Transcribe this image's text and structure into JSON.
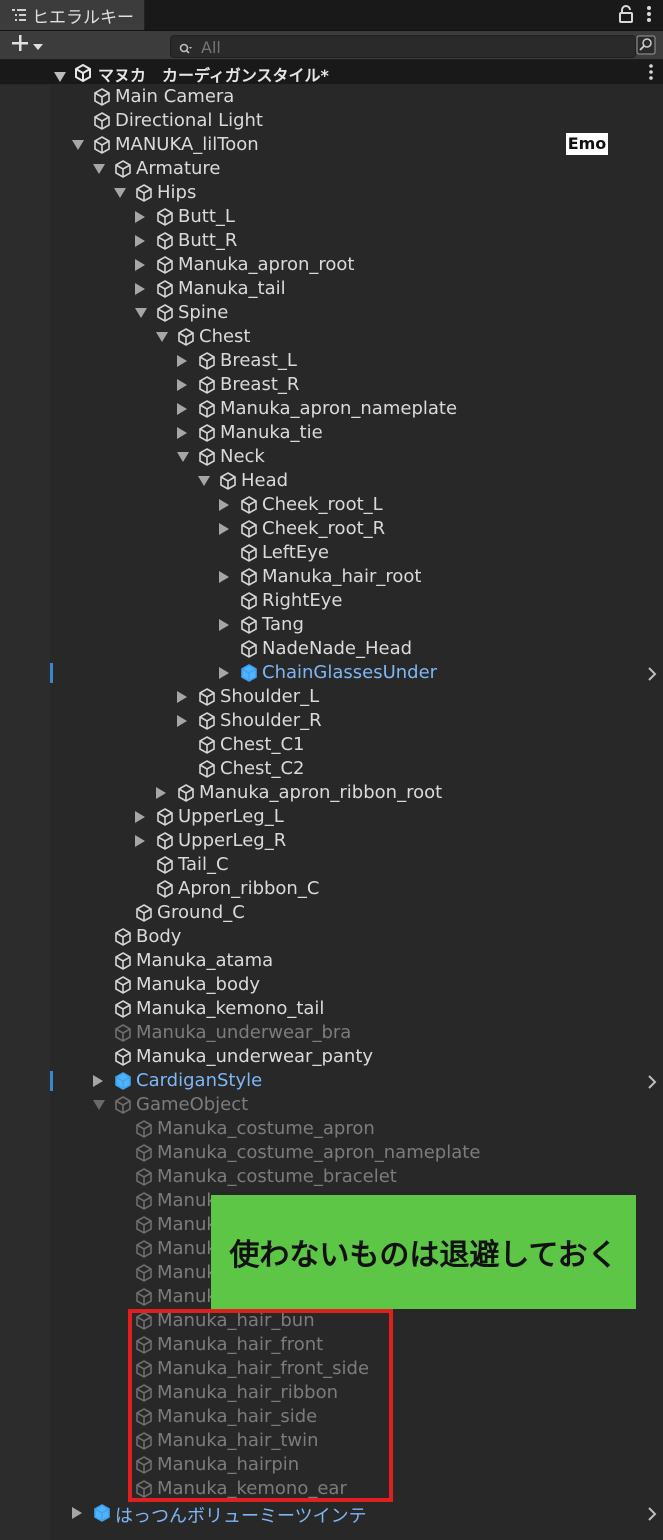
{
  "tab": {
    "label": "ヒエラルキー"
  },
  "search": {
    "placeholder": "All",
    "value": ""
  },
  "scene": {
    "title": "マヌカ　カーディガンスタイル*"
  },
  "badge": {
    "text": "Emo"
  },
  "callout": {
    "text": "使わないものは退避しておく"
  },
  "colors": {
    "background": "#282828",
    "prefab": "#7fb6f4",
    "inactive": "#7c7c7c",
    "callout": "#5ec646",
    "highlight": "#e0201e"
  },
  "rows": [
    {
      "label": "Main Camera",
      "depth": 0,
      "arrow": "none",
      "state": "normal"
    },
    {
      "label": "Directional Light",
      "depth": 0,
      "arrow": "none",
      "state": "normal"
    },
    {
      "label": "MANUKA_lilToon",
      "depth": 0,
      "arrow": "expanded",
      "state": "normal"
    },
    {
      "label": "Armature",
      "depth": 1,
      "arrow": "expanded",
      "state": "normal"
    },
    {
      "label": "Hips",
      "depth": 2,
      "arrow": "expanded",
      "state": "normal"
    },
    {
      "label": "Butt_L",
      "depth": 3,
      "arrow": "collapsed",
      "state": "normal"
    },
    {
      "label": "Butt_R",
      "depth": 3,
      "arrow": "collapsed",
      "state": "normal"
    },
    {
      "label": "Manuka_apron_root",
      "depth": 3,
      "arrow": "collapsed",
      "state": "normal"
    },
    {
      "label": "Manuka_tail",
      "depth": 3,
      "arrow": "collapsed",
      "state": "normal"
    },
    {
      "label": "Spine",
      "depth": 3,
      "arrow": "expanded",
      "state": "normal"
    },
    {
      "label": "Chest",
      "depth": 4,
      "arrow": "expanded",
      "state": "normal"
    },
    {
      "label": "Breast_L",
      "depth": 5,
      "arrow": "collapsed",
      "state": "normal"
    },
    {
      "label": "Breast_R",
      "depth": 5,
      "arrow": "collapsed",
      "state": "normal"
    },
    {
      "label": "Manuka_apron_nameplate",
      "depth": 5,
      "arrow": "collapsed",
      "state": "normal"
    },
    {
      "label": "Manuka_tie",
      "depth": 5,
      "arrow": "collapsed",
      "state": "normal"
    },
    {
      "label": "Neck",
      "depth": 5,
      "arrow": "expanded",
      "state": "normal"
    },
    {
      "label": "Head",
      "depth": 6,
      "arrow": "expanded",
      "state": "normal"
    },
    {
      "label": "Cheek_root_L",
      "depth": 7,
      "arrow": "collapsed",
      "state": "normal"
    },
    {
      "label": "Cheek_root_R",
      "depth": 7,
      "arrow": "collapsed",
      "state": "normal"
    },
    {
      "label": "LeftEye",
      "depth": 7,
      "arrow": "none",
      "state": "normal"
    },
    {
      "label": "Manuka_hair_root",
      "depth": 7,
      "arrow": "collapsed",
      "state": "normal"
    },
    {
      "label": "RightEye",
      "depth": 7,
      "arrow": "none",
      "state": "normal"
    },
    {
      "label": "Tang",
      "depth": 7,
      "arrow": "collapsed",
      "state": "normal"
    },
    {
      "label": "NadeNade_Head",
      "depth": 7,
      "arrow": "none",
      "state": "normal"
    },
    {
      "label": "ChainGlassesUnder",
      "depth": 7,
      "arrow": "collapsed",
      "state": "prefab"
    },
    {
      "label": "Shoulder_L",
      "depth": 5,
      "arrow": "collapsed",
      "state": "normal"
    },
    {
      "label": "Shoulder_R",
      "depth": 5,
      "arrow": "collapsed",
      "state": "normal"
    },
    {
      "label": "Chest_C1",
      "depth": 5,
      "arrow": "none",
      "state": "normal"
    },
    {
      "label": "Chest_C2",
      "depth": 5,
      "arrow": "none",
      "state": "normal"
    },
    {
      "label": "Manuka_apron_ribbon_root",
      "depth": 4,
      "arrow": "collapsed",
      "state": "normal"
    },
    {
      "label": "UpperLeg_L",
      "depth": 3,
      "arrow": "collapsed",
      "state": "normal"
    },
    {
      "label": "UpperLeg_R",
      "depth": 3,
      "arrow": "collapsed",
      "state": "normal"
    },
    {
      "label": "Tail_C",
      "depth": 3,
      "arrow": "none",
      "state": "normal"
    },
    {
      "label": "Apron_ribbon_C",
      "depth": 3,
      "arrow": "none",
      "state": "normal"
    },
    {
      "label": "Ground_C",
      "depth": 2,
      "arrow": "none",
      "state": "normal"
    },
    {
      "label": "Body",
      "depth": 1,
      "arrow": "none",
      "state": "normal"
    },
    {
      "label": "Manuka_atama",
      "depth": 1,
      "arrow": "none",
      "state": "normal"
    },
    {
      "label": "Manuka_body",
      "depth": 1,
      "arrow": "none",
      "state": "normal"
    },
    {
      "label": "Manuka_kemono_tail",
      "depth": 1,
      "arrow": "none",
      "state": "normal"
    },
    {
      "label": "Manuka_underwear_bra",
      "depth": 1,
      "arrow": "none",
      "state": "inactive"
    },
    {
      "label": "Manuka_underwear_panty",
      "depth": 1,
      "arrow": "none",
      "state": "normal"
    },
    {
      "label": "CardiganStyle",
      "depth": 1,
      "arrow": "collapsed",
      "state": "prefab"
    },
    {
      "label": "GameObject",
      "depth": 1,
      "arrow": "expanded",
      "state": "inactive"
    },
    {
      "label": "Manuka_costume_apron",
      "depth": 2,
      "arrow": "none",
      "state": "inactive"
    },
    {
      "label": "Manuka_costume_apron_nameplate",
      "depth": 2,
      "arrow": "none",
      "state": "inactive"
    },
    {
      "label": "Manuka_costume_bracelet",
      "depth": 2,
      "arrow": "none",
      "state": "inactive"
    },
    {
      "label": "Manuka",
      "depth": 2,
      "arrow": "none",
      "state": "inactive"
    },
    {
      "label": "Manuka",
      "depth": 2,
      "arrow": "none",
      "state": "inactive"
    },
    {
      "label": "Manuka",
      "depth": 2,
      "arrow": "none",
      "state": "inactive"
    },
    {
      "label": "Manuka",
      "depth": 2,
      "arrow": "none",
      "state": "inactive"
    },
    {
      "label": "Manuka",
      "depth": 2,
      "arrow": "none",
      "state": "inactive"
    },
    {
      "label": "Manuka_hair_bun",
      "depth": 2,
      "arrow": "none",
      "state": "inactive"
    },
    {
      "label": "Manuka_hair_front",
      "depth": 2,
      "arrow": "none",
      "state": "inactive"
    },
    {
      "label": "Manuka_hair_front_side",
      "depth": 2,
      "arrow": "none",
      "state": "inactive"
    },
    {
      "label": "Manuka_hair_ribbon",
      "depth": 2,
      "arrow": "none",
      "state": "inactive"
    },
    {
      "label": "Manuka_hair_side",
      "depth": 2,
      "arrow": "none",
      "state": "inactive"
    },
    {
      "label": "Manuka_hair_twin",
      "depth": 2,
      "arrow": "none",
      "state": "inactive"
    },
    {
      "label": "Manuka_hairpin",
      "depth": 2,
      "arrow": "none",
      "state": "inactive"
    },
    {
      "label": "Manuka_kemono_ear",
      "depth": 2,
      "arrow": "none",
      "state": "inactive"
    },
    {
      "label": "はっつんボリューミーツインテ",
      "depth": 0,
      "arrow": "collapsed",
      "state": "prefab"
    }
  ]
}
